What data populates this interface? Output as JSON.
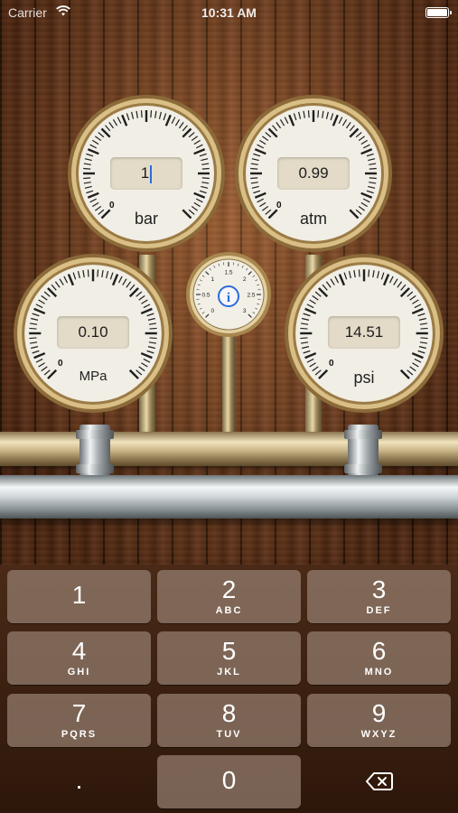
{
  "status_bar": {
    "carrier": "Carrier",
    "time": "10:31 AM"
  },
  "gauges": {
    "bar": {
      "value": "1",
      "unit": "bar",
      "zero": "0"
    },
    "atm": {
      "value": "0.99",
      "unit": "atm",
      "zero": "0"
    },
    "mpa": {
      "value": "0.10",
      "unit": "MPa",
      "zero": "0"
    },
    "psi": {
      "value": "14.51",
      "unit": "psi",
      "zero": "0"
    },
    "info": {
      "scale": [
        "0",
        "0.5",
        "1",
        "1.5",
        "2",
        "2.5",
        "3"
      ],
      "icon": "info-icon"
    }
  },
  "keypad": {
    "keys": [
      {
        "digit": "1",
        "letters": ""
      },
      {
        "digit": "2",
        "letters": "ABC"
      },
      {
        "digit": "3",
        "letters": "DEF"
      },
      {
        "digit": "4",
        "letters": "GHI"
      },
      {
        "digit": "5",
        "letters": "JKL"
      },
      {
        "digit": "6",
        "letters": "MNO"
      },
      {
        "digit": "7",
        "letters": "PQRS"
      },
      {
        "digit": "8",
        "letters": "TUV"
      },
      {
        "digit": "9",
        "letters": "WXYZ"
      }
    ],
    "decimal": ".",
    "zero": "0",
    "delete_icon": "backspace-icon"
  },
  "colors": {
    "accent_blue": "#2c6bdc",
    "gauge_face": "#efece2",
    "brass": "#c9a96a"
  }
}
